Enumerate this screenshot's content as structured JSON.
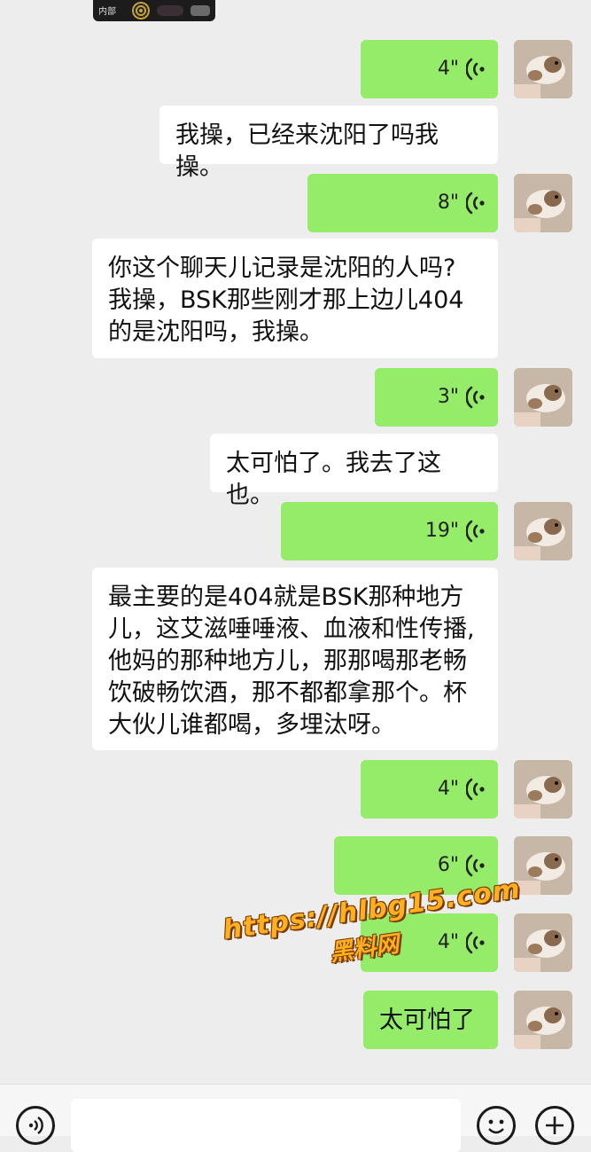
{
  "top_thumbnail": {
    "tag": "内部"
  },
  "messages": [
    {
      "kind": "voice",
      "side": "right",
      "duration": "4\""
    },
    {
      "kind": "text",
      "side": "left",
      "lines": [
        "我操，已经来沈阳了吗我操。"
      ]
    },
    {
      "kind": "voice",
      "side": "right",
      "duration": "8\""
    },
    {
      "kind": "text",
      "side": "left",
      "lines": [
        "你这个聊天儿记录是沈阳的人吗?",
        "我操，BSK那些刚才那上边儿404",
        "的是沈阳吗，我操。"
      ]
    },
    {
      "kind": "voice",
      "side": "right",
      "duration": "3\""
    },
    {
      "kind": "text",
      "side": "left",
      "lines": [
        "太可怕了。我去了这也。"
      ]
    },
    {
      "kind": "voice",
      "side": "right",
      "duration": "19\""
    },
    {
      "kind": "text",
      "side": "left",
      "lines": [
        "最主要的是404就是BSK那种地方",
        "儿，这艾滋唾唾液、血液和性传播,",
        "他妈的那种地方儿，那那喝那老畅",
        "饮破畅饮酒，那不都都拿那个。杯",
        "大伙儿谁都喝，多埋汰呀。"
      ]
    },
    {
      "kind": "voice",
      "side": "right",
      "duration": "4\""
    },
    {
      "kind": "voice",
      "side": "right",
      "duration": "6\""
    },
    {
      "kind": "voice",
      "side": "right",
      "duration": "4\""
    },
    {
      "kind": "text",
      "side": "right",
      "lines": [
        "太可怕了"
      ]
    }
  ],
  "watermark": {
    "url": "https://hlbg15.com",
    "name": "黑料网"
  },
  "input_bar": {
    "voice_toggle_icon": "voice-icon",
    "emoji_icon": "emoji-icon",
    "plus_icon": "plus-icon"
  },
  "colors": {
    "sent_bubble": "#95ec69",
    "received_bubble": "#ffffff",
    "background": "#ededed"
  }
}
